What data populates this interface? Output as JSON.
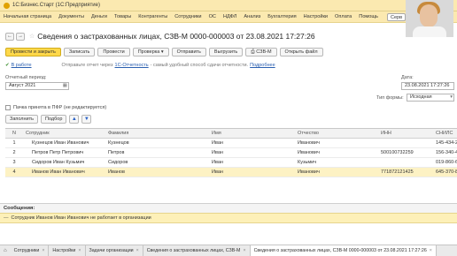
{
  "window": {
    "title": "1С:Бизнес.Старт (1С:Предприятие)"
  },
  "menu": {
    "items": [
      "Начальная страница",
      "Документы",
      "Деньги",
      "Товары",
      "Контрагенты",
      "Сотрудники",
      "ОС",
      "НДФЛ",
      "Анализ",
      "Бухгалтерия",
      "Настройки",
      "Оплата",
      "Помощь"
    ],
    "server_button": "Серв"
  },
  "document": {
    "title": "Сведения о застрахованных лицах, СЗВ-М 0000-000003 от 23.08.2021 17:27:26"
  },
  "toolbar": {
    "post_close": "Провести и закрыть",
    "save": "Записать",
    "post": "Провести",
    "check": "Проверка",
    "send": "Отправить",
    "export": "Выгрузить",
    "szvm": "СЗВ-М",
    "open_file": "Открыть файл"
  },
  "status": {
    "state": "В работе",
    "text_before": "Отправьте отчет через",
    "link": "1С-Отчетность",
    "text_after": "- самый удобный способ сдачи отчетности.",
    "link2": "Подробнее"
  },
  "period": {
    "label": "Отчетный период:",
    "value": "Август 2021"
  },
  "date": {
    "label": "Дата:",
    "value": "23.08.2021 17:27:26"
  },
  "form_type": {
    "label": "Тип формы:",
    "value": "Исходная"
  },
  "pfr_checkbox": {
    "label": "Пачка принята в ПФР (не редактируется)",
    "checked": false
  },
  "table_toolbar": {
    "fill": "Заполнить",
    "select": "Подбор"
  },
  "table": {
    "columns": [
      "N",
      "Сотрудник",
      "Фамилия",
      "Имя",
      "Отчество",
      "ИНН",
      "СНИЛС"
    ],
    "rows": [
      {
        "n": "1",
        "employee": "Кузнецов Иван Иванович",
        "last": "Кузнецов",
        "first": "Иван",
        "middle": "Иванович",
        "inn": "",
        "snils": "145-434-2"
      },
      {
        "n": "2",
        "employee": "Петров Петр Петрович",
        "last": "Петров",
        "first": "Иван",
        "middle": "Иванович",
        "inn": "500100732259",
        "snils": "156-340-4"
      },
      {
        "n": "3",
        "employee": "Сидоров Иван Кузьмич",
        "last": "Сидоров",
        "first": "Иван",
        "middle": "Кузьмич",
        "inn": "",
        "snils": "019-860-6"
      },
      {
        "n": "4",
        "employee": "Иванов Иван Иванович",
        "last": "Иванов",
        "first": "Иван",
        "middle": "Иванович",
        "inn": "771872121425",
        "snils": "645-370-8"
      }
    ],
    "selected_row": 3
  },
  "messages": {
    "header": "Сообщения:",
    "items": [
      "Сотрудник Иванов Иван Иванович не работает в организации"
    ]
  },
  "tabs": [
    "Сотрудники",
    "Настройки",
    "Задачи организации",
    "Сведения о застрахованных лицах, СЗВ-М",
    "Сведения о застрахованных лицах, СЗВ-М 0000-000003 от 23.08.2021 17:27:26"
  ]
}
